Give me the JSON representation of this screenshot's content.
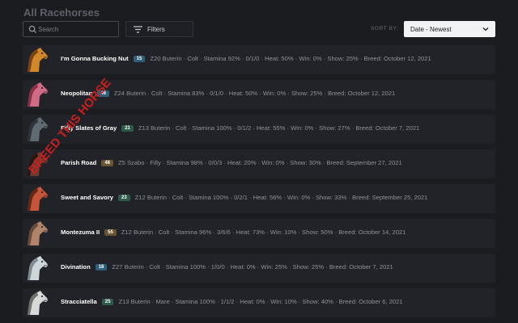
{
  "page": {
    "title": "All Racehorses"
  },
  "search": {
    "placeholder": "Search",
    "value": ""
  },
  "filters": {
    "label": "Filters"
  },
  "sort": {
    "label": "SORT BY:",
    "selected": "Date - Newest"
  },
  "horses": [
    {
      "name": "I'm Gonna Bucking Nut",
      "number": "15",
      "badge_color": "#2f5f7a",
      "details": "Z20 Buterin · Colt · Stamina 92% · 0/1/0 · Heat: 50% · Win: 0% · Show: 25% · Breed: October 12, 2021",
      "coat": "#d2872a",
      "mane": "#7a4310",
      "cover": "orange"
    },
    {
      "name": "Neopolitan",
      "number": "46",
      "badge_color": "#2f5f7a",
      "details": "Z24 Buterin · Colt · Stamina 83% · 0/1/0 · Heat: 50% · Win: 0% · Show: 25% · Breed: October 12, 2021",
      "coat": "#d06b86",
      "mane": "#8a2f45",
      "cover": "pink"
    },
    {
      "name": "Fifty Slates of Gray",
      "number": "21",
      "badge_color": "#2e5a49",
      "details": "Z13 Buterin · Colt · Stamina 100% · 0/1/2 · Heat: 55% · Win: 0% · Show: 27% · Breed: October 7, 2021",
      "coat": "#5f6a73",
      "mane": "#2e3338",
      "cover": "gray"
    },
    {
      "name": "Parish Road",
      "number": "48",
      "badge_color": "#6a5431",
      "details": "Z5 Szabo · Filly · Stamina 98% · 0/0/3 · Heat: 20% · Win: 0% · Show: 30% · Breed: September 27, 2021",
      "coat": "#6e3a30",
      "mane": "#2b1410",
      "cover": "brown"
    },
    {
      "name": "Sweet and Savory",
      "number": "23",
      "badge_color": "#2e5a49",
      "details": "Z12 Buterin · Colt · Stamina 100% · 0/2/1 · Heat: 56% · Win: 0% · Show: 33% · Breed: September 25, 2021",
      "coat": "#c4553a",
      "mane": "#6a2515",
      "cover": "red"
    },
    {
      "name": "Montezuma II",
      "number": "55",
      "badge_color": "#6a5431",
      "details": "Z12 Buterin · Colt · Stamina 96% · 3/6/6 · Heat: 73% · Win: 10% · Show: 50% · Breed: October 14, 2021",
      "coat": "#b0846a",
      "mane": "#6a4a38",
      "cover": "tan"
    },
    {
      "name": "Divination",
      "number": "18",
      "badge_color": "#2f5f7a",
      "details": "Z27 Buterin · Colt · Stamina 100% · 1/0/0 · Heat: 0% · Win: 25% · Show: 25% · Breed: October 7, 2021",
      "coat": "#cfd6da",
      "mane": "#7f8b93",
      "cover": "white"
    },
    {
      "name": "Stracciatella",
      "number": "25",
      "badge_color": "#2e5a49",
      "details": "Z13 Buterin · Mare · Stamina 100% · 1/1/2 · Heat: 0% · Win: 10% · Show: 40% · Breed: October 6, 2021",
      "coat": "#d7d9d8",
      "mane": "#6f6f6c",
      "cover": "white"
    }
  ],
  "stamp": {
    "text": "BREED THIS HORSE",
    "color": "#c81f1f"
  }
}
